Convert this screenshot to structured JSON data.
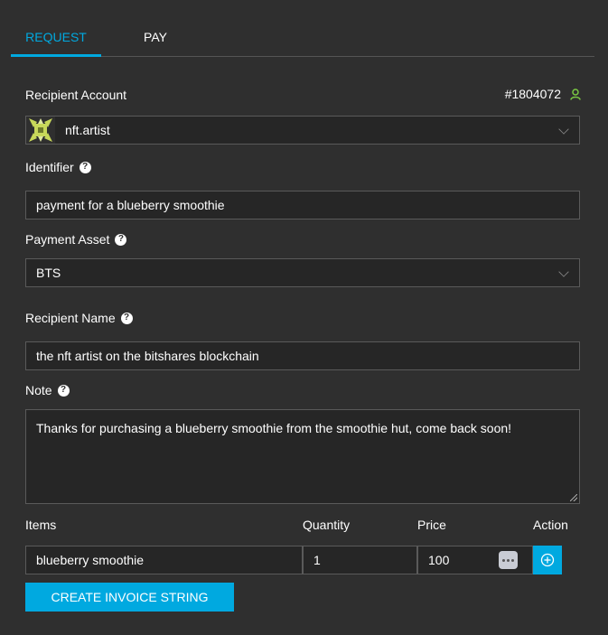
{
  "tabs": [
    {
      "label": "REQUEST",
      "active": true
    },
    {
      "label": "PAY",
      "active": false
    }
  ],
  "recipient_account": {
    "label": "Recipient Account",
    "account_number": "#1804072",
    "value": "nft.artist"
  },
  "identifier": {
    "label": "Identifier",
    "value": "payment for a blueberry smoothie"
  },
  "payment_asset": {
    "label": "Payment Asset",
    "value": "BTS"
  },
  "recipient_name": {
    "label": "Recipient Name",
    "value": "the nft artist on the bitshares blockchain"
  },
  "note": {
    "label": "Note",
    "value": "Thanks for purchasing a blueberry smoothie from the smoothie hut, come back soon!"
  },
  "items": {
    "headers": {
      "items": "Items",
      "quantity": "Quantity",
      "price": "Price",
      "action": "Action"
    },
    "rows": [
      {
        "name": "blueberry smoothie",
        "quantity": "1",
        "price": "100"
      }
    ]
  },
  "create_button_label": "CREATE INVOICE STRING",
  "colors": {
    "accent": "#00a9e0",
    "background": "#2f2f2f",
    "field_bg": "#262626",
    "account_icon": "#7ac943"
  },
  "icons": {
    "help": "question-circle-icon",
    "user": "user-icon",
    "chevron": "chevron-down-icon",
    "more": "more-dots-icon",
    "add": "plus-circle-icon"
  }
}
